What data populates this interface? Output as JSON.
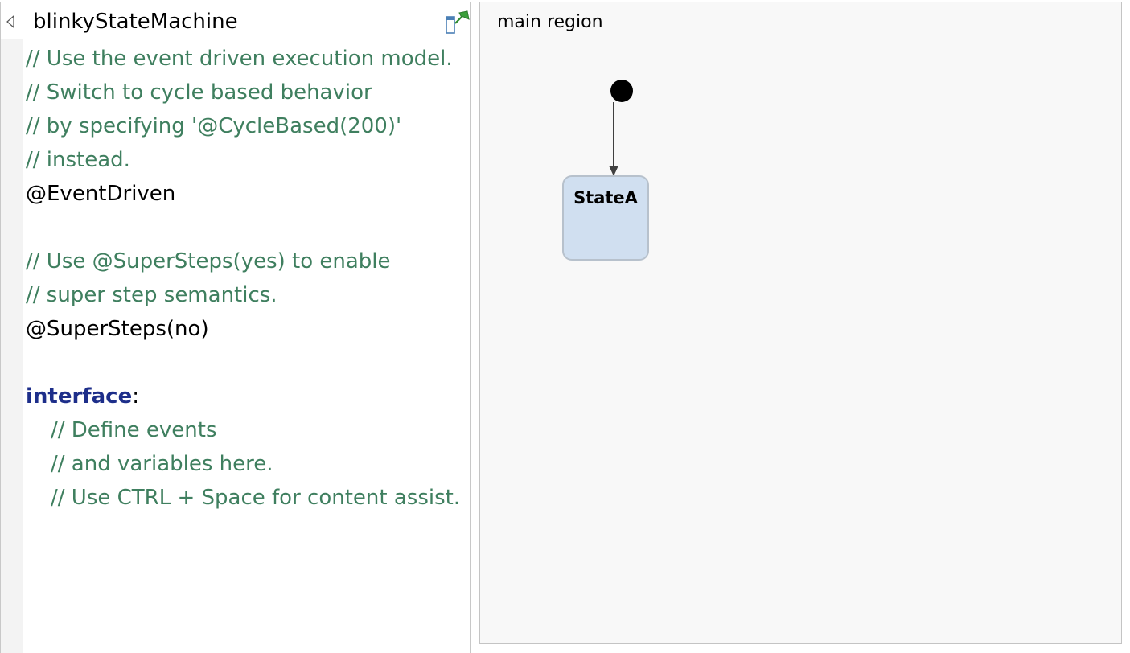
{
  "definition_section": {
    "title": "blinkyStateMachine",
    "collapse_icon": "collapse-arrow-icon",
    "pin_icon": "pin-icon",
    "lines": [
      {
        "text": "// Use the event driven execution model.",
        "kind": "comment"
      },
      {
        "text": "// Switch to cycle based behavior",
        "kind": "comment"
      },
      {
        "text": "// by specifying '@CycleBased(200)'",
        "kind": "comment"
      },
      {
        "text": "// instead.",
        "kind": "comment"
      },
      {
        "text": "@EventDriven",
        "kind": "annotation"
      },
      {
        "text": "",
        "kind": "blank"
      },
      {
        "text": "// Use @SuperSteps(yes) to enable",
        "kind": "comment"
      },
      {
        "text": "// super step semantics.",
        "kind": "comment"
      },
      {
        "text": "@SuperSteps(no)",
        "kind": "annotation"
      },
      {
        "text": "",
        "kind": "blank"
      },
      {
        "keyword": "interface",
        "punct": ":",
        "kind": "keyword"
      },
      {
        "text": "// Define events",
        "kind": "comment-indent"
      },
      {
        "text": "// and variables here.",
        "kind": "comment-indent"
      },
      {
        "text": "// Use CTRL + Space for content assist.",
        "kind": "comment-indent"
      }
    ]
  },
  "diagram": {
    "region_label": "main region",
    "states": [
      {
        "name": "StateA"
      }
    ],
    "colors": {
      "state_fill": "#d0dff0",
      "state_border": "#b7c1cc",
      "comment": "#3f7f5f",
      "keyword": "#1d2e8a"
    }
  }
}
